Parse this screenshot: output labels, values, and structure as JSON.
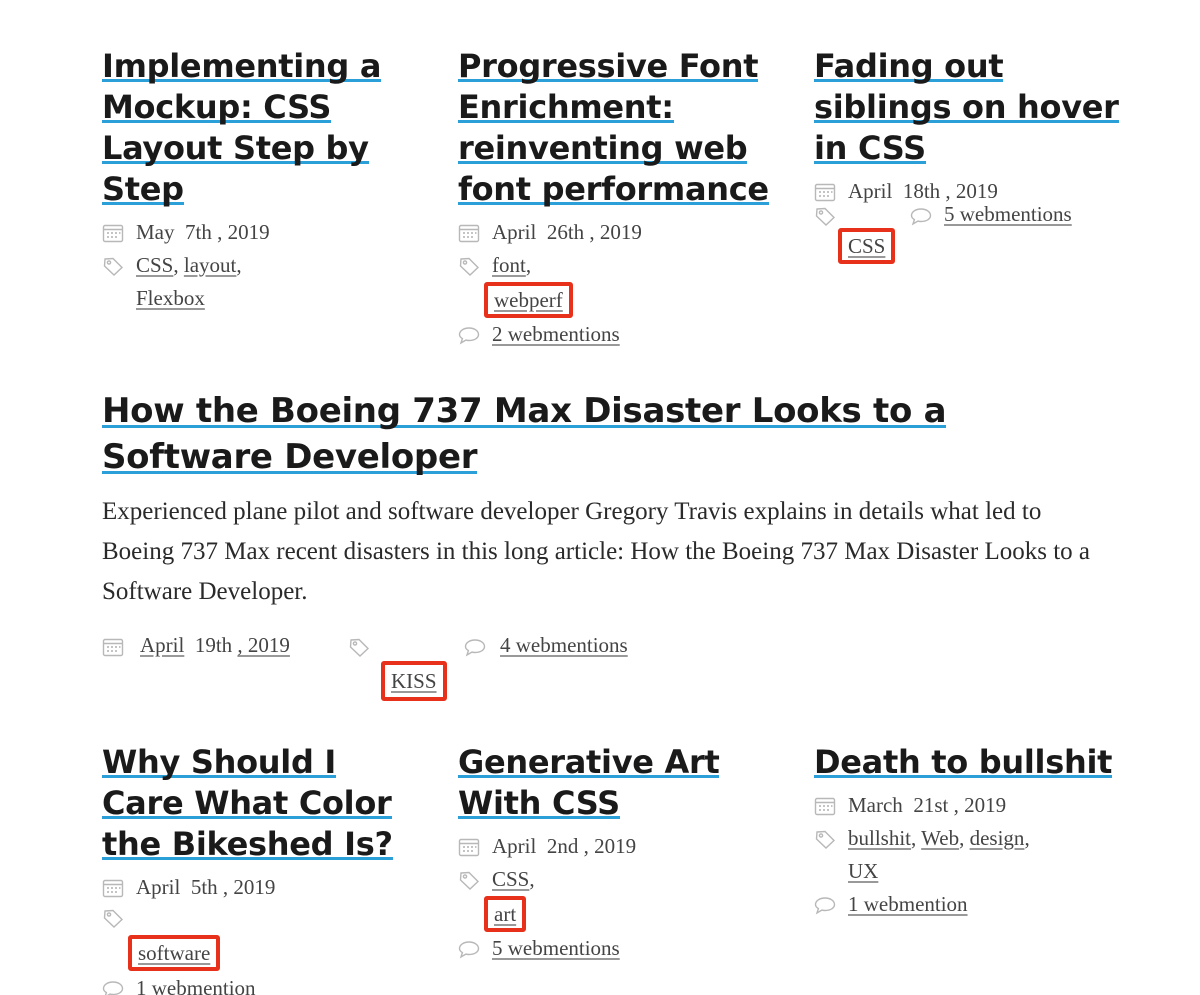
{
  "posts": [
    {
      "title": "Implementing a Mockup: CSS Layout Step by Step",
      "date_month": "May",
      "date_day": "7th",
      "date_year": ", 2019",
      "tags": [
        "CSS",
        "layout",
        "Flexbox"
      ]
    },
    {
      "title": "Progressive Font Enrichment: reinventing web font performance",
      "date_month": "April",
      "date_day": "26th",
      "date_year": ", 2019",
      "tags": [
        "font",
        "webperf"
      ],
      "webmentions": "2 webmentions"
    },
    {
      "title": "Fading out siblings on hover in CSS",
      "date_month": "April",
      "date_day": "18th",
      "date_year": ", 2019",
      "tags": [
        "CSS"
      ],
      "webmentions": "5 webmentions"
    },
    {
      "title": "How the Boeing 737 Max Disaster Looks to a Software Developer",
      "excerpt": "Experienced plane pilot and software developer Gregory Travis explains in details what led to Boeing 737 Max recent disasters in this long article: How the Boeing 737 Max Disaster Looks to a Software Developer.",
      "date_month": "April",
      "date_day": "19th",
      "date_year": ", 2019",
      "tags": [
        "KISS"
      ],
      "webmentions": "4 webmentions"
    },
    {
      "title": "Why Should I Care What Color the Bikeshed Is?",
      "date_month": "April",
      "date_day": "5th",
      "date_year": ", 2019",
      "tags": [
        "software"
      ],
      "webmentions": "1 webmention"
    },
    {
      "title": "Generative Art With CSS",
      "date_month": "April",
      "date_day": "2nd",
      "date_year": ", 2019",
      "tags": [
        "CSS",
        "art"
      ],
      "webmentions": "5 webmentions"
    },
    {
      "title": "Death to bullshit",
      "date_month": "March",
      "date_day": "21st",
      "date_year": ", 2019",
      "tags": [
        "bullshit",
        "Web",
        "design",
        "UX"
      ],
      "webmentions": "1 webmention"
    }
  ],
  "icons": {
    "date": "calendar-icon",
    "tags": "tag-icon",
    "mentions": "speech-bubble-icon"
  },
  "colors": {
    "title_underline": "#2a9fd8",
    "highlight_box": "#e8311a"
  }
}
